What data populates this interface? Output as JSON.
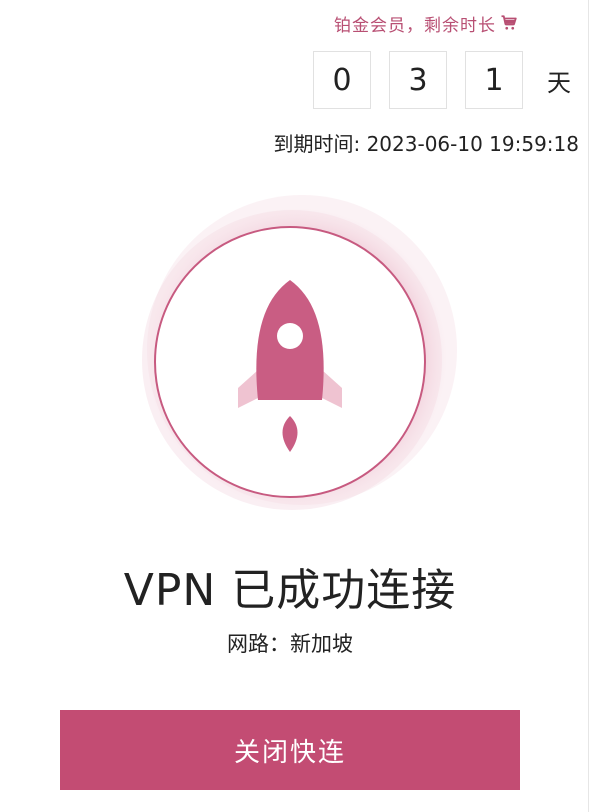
{
  "membership": {
    "label": "铂金会员，剩余时长",
    "cart_icon": "cart-icon",
    "accent_color": "#b84f73"
  },
  "remaining": {
    "digits": [
      "0",
      "3",
      "1"
    ],
    "unit": "天"
  },
  "expiry": {
    "text": "到期时间: 2023-06-10 19:59:18"
  },
  "connection": {
    "icon": "rocket-icon",
    "status": "VPN 已成功连接",
    "route": "网路：新加坡"
  },
  "action": {
    "disconnect_label": "关闭快连",
    "button_color": "#c34c73"
  }
}
